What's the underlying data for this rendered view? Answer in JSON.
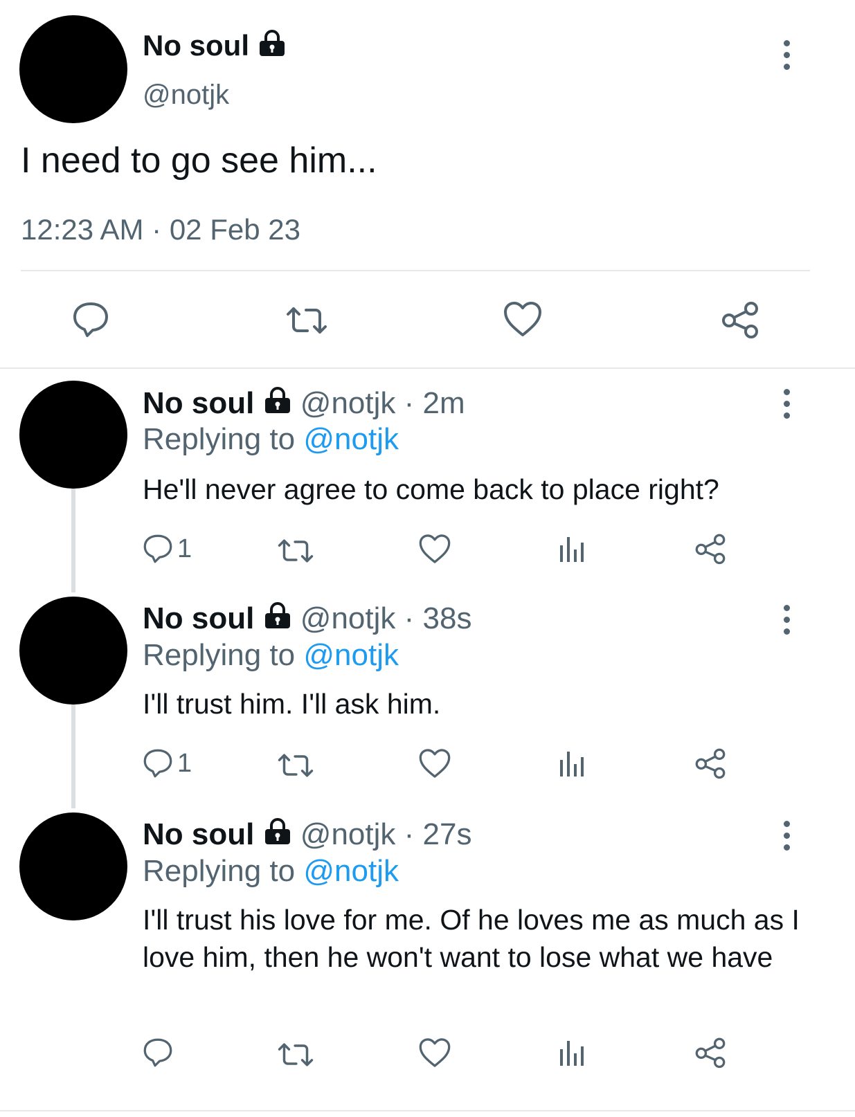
{
  "main_tweet": {
    "display_name": "No soul",
    "handle": "@notjk",
    "text": "I need to go see him...",
    "time": "12:23 AM",
    "separator": "·",
    "date": "02 Feb 23"
  },
  "replies": [
    {
      "display_name": "No soul",
      "handle": "@notjk",
      "age": "2m",
      "replying_prefix": "Replying to",
      "replying_to": "@notjk",
      "text": "He'll never agree to come back to place right?",
      "reply_count": "1"
    },
    {
      "display_name": "No soul",
      "handle": "@notjk",
      "age": "38s",
      "replying_prefix": "Replying to",
      "replying_to": "@notjk",
      "text": "I'll trust him. I'll ask him.",
      "reply_count": "1"
    },
    {
      "display_name": "No soul",
      "handle": "@notjk",
      "age": "27s",
      "replying_prefix": "Replying to",
      "replying_to": "@notjk",
      "text": "I'll trust his love for me. Of he loves me as much as I love him, then he won't want to lose what we have",
      "reply_count": ""
    }
  ],
  "icons": {
    "lock": "lock-icon",
    "more": "more-vertical-icon",
    "reply": "reply-bubble-icon",
    "retweet": "retweet-icon",
    "like": "heart-icon",
    "views": "views-bar-icon",
    "share": "share-icon"
  },
  "colors": {
    "text": "#0f1419",
    "muted": "#536471",
    "link": "#1d9bf0",
    "avatar": "#000000"
  }
}
